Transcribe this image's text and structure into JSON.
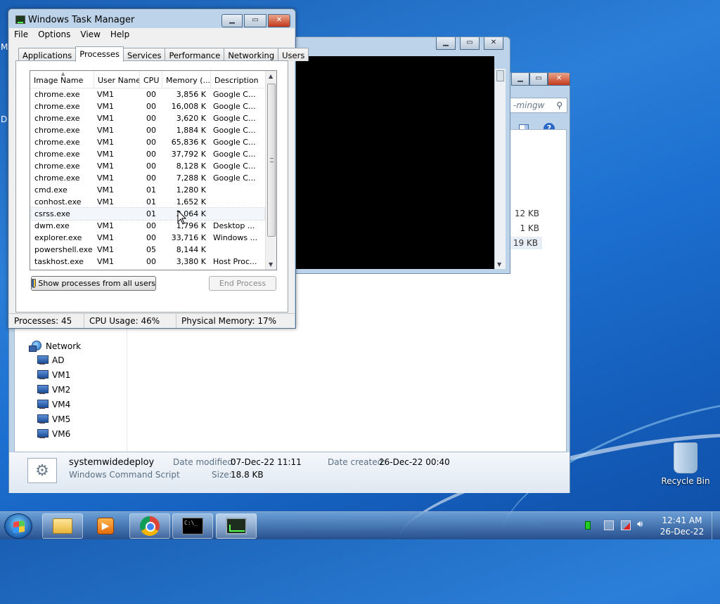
{
  "desktop": {
    "edge_letters": [
      "M",
      "D"
    ],
    "recycle_bin_label": "Recycle Bin"
  },
  "explorer": {
    "search_text": "-mingw",
    "nav": {
      "network_label": "Network",
      "computers": [
        "AD",
        "VM1",
        "VM2",
        "VM4",
        "VM5",
        "VM6"
      ]
    },
    "file_sizes": [
      "12 KB",
      "1 KB",
      "19 KB"
    ],
    "details": {
      "name": "systemwidedeploy",
      "type": "Windows Command Script",
      "date_modified_label": "Date modified:",
      "date_modified": "07-Dec-22 11:11",
      "date_created_label": "Date created:",
      "date_created": "26-Dec-22 00:40",
      "size_label": "Size:",
      "size": "18.8 KB"
    }
  },
  "task_manager": {
    "title": "Windows Task Manager",
    "menu": [
      "File",
      "Options",
      "View",
      "Help"
    ],
    "tabs": [
      "Applications",
      "Processes",
      "Services",
      "Performance",
      "Networking",
      "Users"
    ],
    "active_tab": "Processes",
    "columns": [
      "Image Name",
      "User Name",
      "CPU",
      "Memory (...",
      "Description"
    ],
    "processes": [
      {
        "name": "chrome.exe",
        "user": "VM1",
        "cpu": "00",
        "mem": "3,856 K",
        "desc": "Google C..."
      },
      {
        "name": "chrome.exe",
        "user": "VM1",
        "cpu": "00",
        "mem": "16,008 K",
        "desc": "Google C..."
      },
      {
        "name": "chrome.exe",
        "user": "VM1",
        "cpu": "00",
        "mem": "3,620 K",
        "desc": "Google C..."
      },
      {
        "name": "chrome.exe",
        "user": "VM1",
        "cpu": "00",
        "mem": "1,884 K",
        "desc": "Google C..."
      },
      {
        "name": "chrome.exe",
        "user": "VM1",
        "cpu": "00",
        "mem": "65,836 K",
        "desc": "Google C..."
      },
      {
        "name": "chrome.exe",
        "user": "VM1",
        "cpu": "00",
        "mem": "37,792 K",
        "desc": "Google C..."
      },
      {
        "name": "chrome.exe",
        "user": "VM1",
        "cpu": "00",
        "mem": "8,128 K",
        "desc": "Google C..."
      },
      {
        "name": "chrome.exe",
        "user": "VM1",
        "cpu": "00",
        "mem": "7,288 K",
        "desc": "Google C..."
      },
      {
        "name": "cmd.exe",
        "user": "VM1",
        "cpu": "01",
        "mem": "1,280 K",
        "desc": ""
      },
      {
        "name": "conhost.exe",
        "user": "VM1",
        "cpu": "01",
        "mem": "1,652 K",
        "desc": ""
      },
      {
        "name": "csrss.exe",
        "user": "",
        "cpu": "01",
        "mem": "2,064 K",
        "desc": ""
      },
      {
        "name": "dwm.exe",
        "user": "VM1",
        "cpu": "00",
        "mem": "1,796 K",
        "desc": "Desktop ..."
      },
      {
        "name": "explorer.exe",
        "user": "VM1",
        "cpu": "00",
        "mem": "33,716 K",
        "desc": "Windows ..."
      },
      {
        "name": "powershell.exe",
        "user": "VM1",
        "cpu": "05",
        "mem": "8,144 K",
        "desc": ""
      },
      {
        "name": "taskhost.exe",
        "user": "VM1",
        "cpu": "00",
        "mem": "3,380 K",
        "desc": "Host Proc..."
      }
    ],
    "hovered_row": 10,
    "show_all_label": "Show processes from all users",
    "end_process_label": "End Process",
    "status": {
      "processes": "Processes: 45",
      "cpu": "CPU Usage: 46%",
      "memory": "Physical Memory: 17%"
    }
  },
  "taskbar": {
    "clock_time": "12:41 AM",
    "clock_date": "26-Dec-22",
    "cmd_glyph_text": "C:\\_"
  }
}
